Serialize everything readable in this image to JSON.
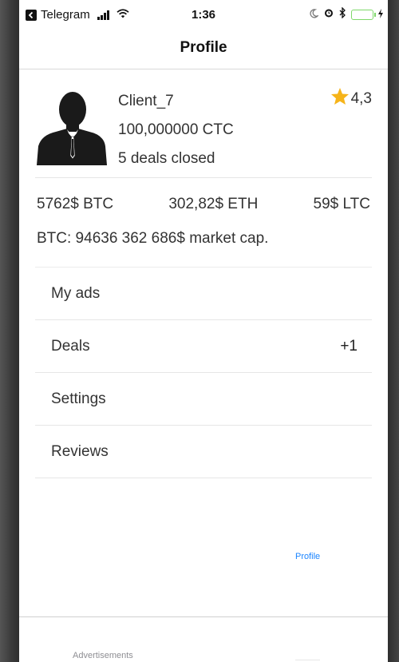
{
  "status_bar": {
    "carrier": "Telegram",
    "time": "1:36"
  },
  "nav": {
    "title": "Profile"
  },
  "profile": {
    "username": "Client_7",
    "balance": "100,000000 CTC",
    "deals_closed": "5 deals closed",
    "rating": "4,3"
  },
  "balances": {
    "btc": "5762$ BTC",
    "eth": "302,82$ ETH",
    "ltc": "59$ LTC",
    "market_cap": "BTC: 94636 362 686$ market cap."
  },
  "menu": {
    "items": [
      {
        "label": "My ads",
        "badge": ""
      },
      {
        "label": "Deals",
        "badge": "+1"
      },
      {
        "label": "Settings",
        "badge": ""
      },
      {
        "label": "Reviews",
        "badge": ""
      }
    ]
  },
  "tabbar": {
    "tabs": [
      {
        "label": "Advertisements",
        "active": false
      },
      {
        "label": "Profile",
        "active": true
      }
    ]
  },
  "colors": {
    "active_tab": "#1a84ff",
    "star": "#f6b41a",
    "battery": "#5fd34b"
  },
  "icons": [
    "telegram-back-icon",
    "signal-icon",
    "wifi-icon",
    "moon-icon",
    "alarm-icon",
    "bluetooth-icon",
    "battery-icon",
    "star-icon",
    "avatar-silhouette"
  ]
}
